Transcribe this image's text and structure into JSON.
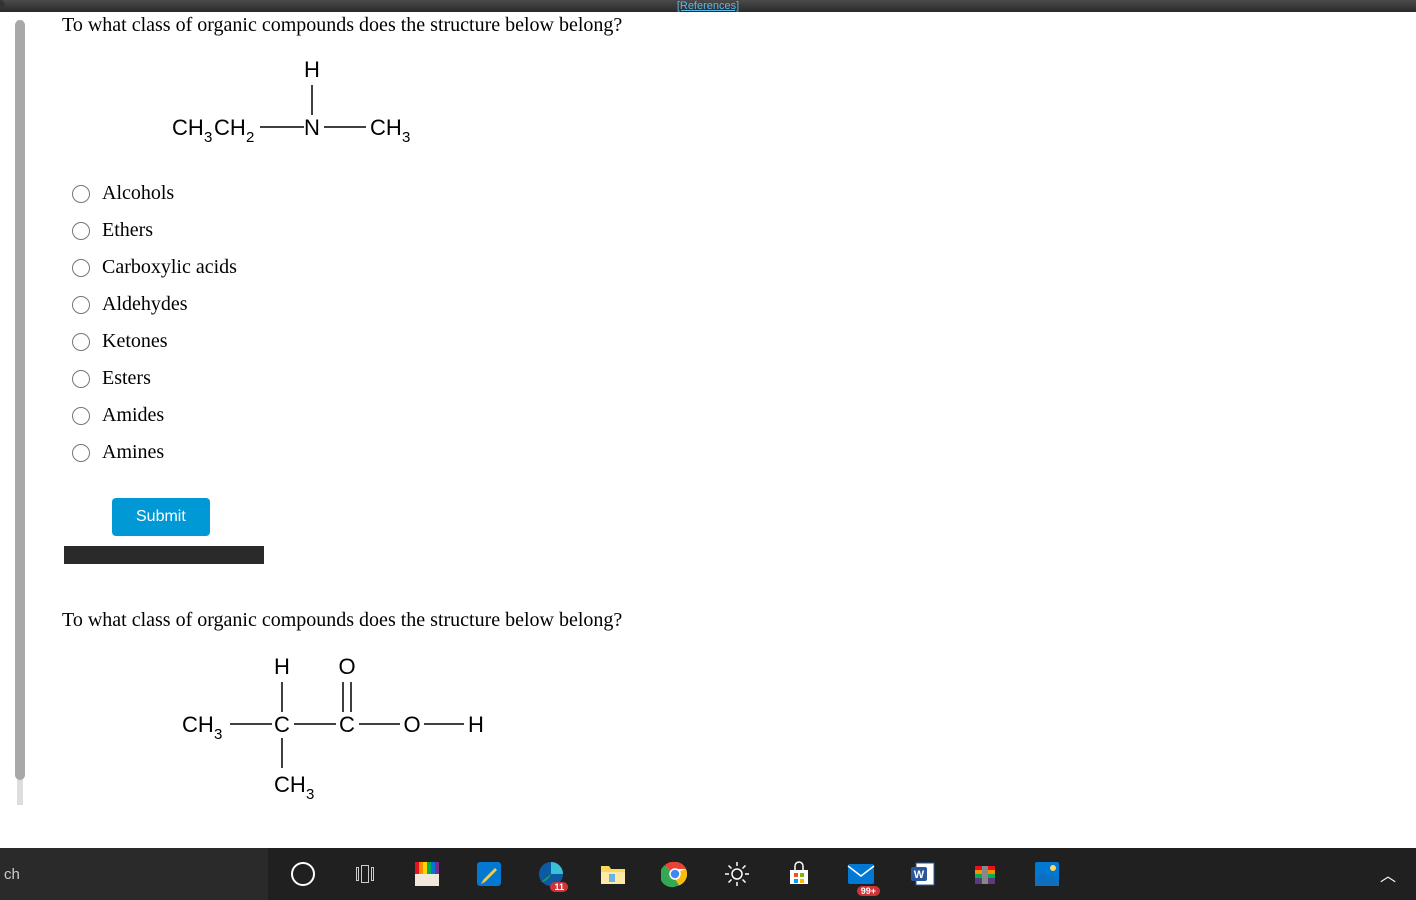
{
  "top_bar": {
    "references_label": "[References]"
  },
  "question1": {
    "text": "To what class of organic compounds does the structure below belong?",
    "structure": {
      "left_group": "CH₃CH₂",
      "center_atom": "N",
      "top_atom": "H",
      "right_group": "CH₃"
    },
    "options": [
      "Alcohols",
      "Ethers",
      "Carboxylic acids",
      "Aldehydes",
      "Ketones",
      "Esters",
      "Amides",
      "Amines"
    ],
    "submit_label": "Submit"
  },
  "question2": {
    "text": "To what class of organic compounds does the structure below belong?",
    "structure": {
      "left_group": "CH₃",
      "c1_top": "H",
      "c1_bottom": "CH₃",
      "c2_top": "O",
      "right_o": "O",
      "right_h": "H"
    }
  },
  "taskbar": {
    "search_label": "ch",
    "badge_11": "11",
    "badge_99": "99+"
  }
}
